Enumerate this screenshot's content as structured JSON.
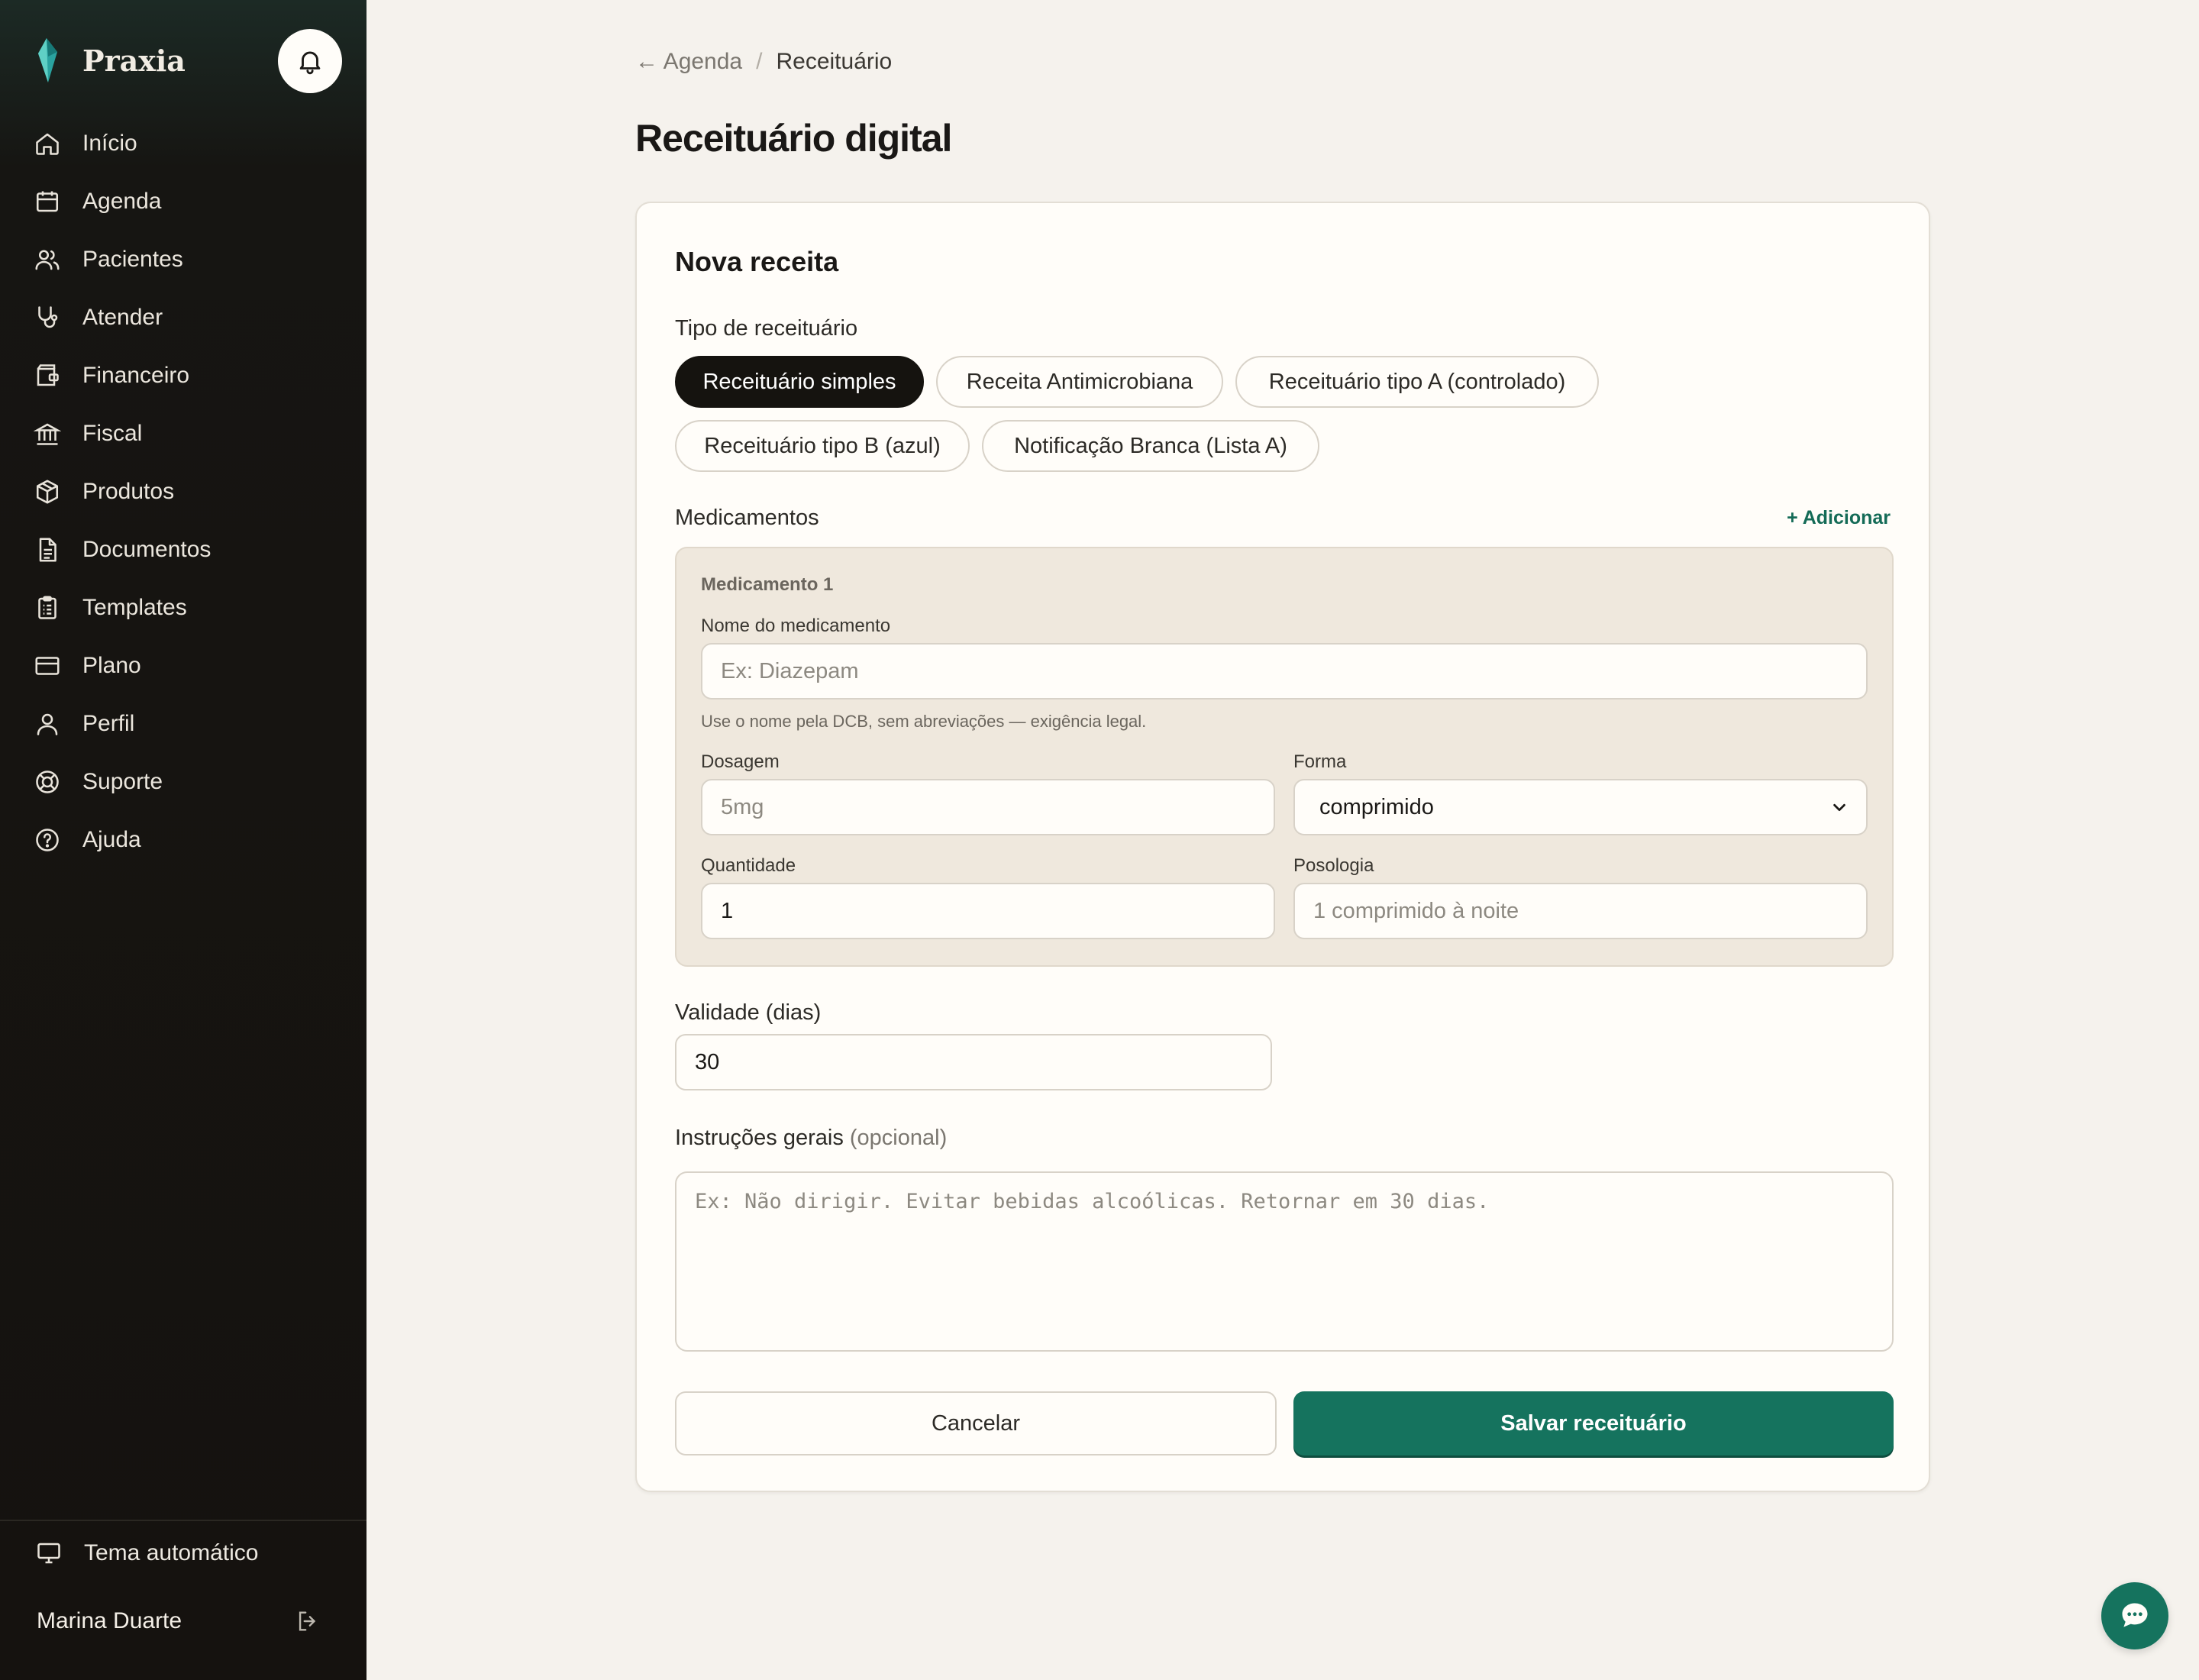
{
  "brand": {
    "name": "Praxia"
  },
  "sidebar": {
    "items": [
      {
        "label": "Início",
        "icon": "home-icon"
      },
      {
        "label": "Agenda",
        "icon": "calendar-icon"
      },
      {
        "label": "Pacientes",
        "icon": "users-icon"
      },
      {
        "label": "Atender",
        "icon": "stethoscope-icon"
      },
      {
        "label": "Financeiro",
        "icon": "wallet-icon"
      },
      {
        "label": "Fiscal",
        "icon": "bank-icon"
      },
      {
        "label": "Produtos",
        "icon": "package-icon"
      },
      {
        "label": "Documentos",
        "icon": "document-icon"
      },
      {
        "label": "Templates",
        "icon": "clipboard-list-icon"
      },
      {
        "label": "Plano",
        "icon": "credit-card-icon"
      },
      {
        "label": "Perfil",
        "icon": "user-icon"
      },
      {
        "label": "Suporte",
        "icon": "lifebuoy-icon"
      },
      {
        "label": "Ajuda",
        "icon": "help-circle-icon"
      }
    ],
    "theme_label": "Tema automático",
    "user_name": "Marina Duarte"
  },
  "breadcrumb": {
    "back": "← Agenda",
    "separator": "/",
    "current": "Receituário"
  },
  "page": {
    "title": "Receituário digital"
  },
  "form": {
    "card_title": "Nova receita",
    "type_label": "Tipo de receituário",
    "types": [
      {
        "label": "Receituário simples",
        "selected": true
      },
      {
        "label": "Receita Antimicrobiana",
        "selected": false
      },
      {
        "label": "Receituário tipo A (controlado)",
        "selected": false
      },
      {
        "label": "Receituário tipo B (azul)",
        "selected": false
      },
      {
        "label": "Notificação Branca (Lista A)",
        "selected": false
      }
    ],
    "medications_label": "Medicamentos",
    "add_label": "+ Adicionar",
    "medication": {
      "title": "Medicamento 1",
      "name_label": "Nome do medicamento",
      "name_placeholder": "Ex: Diazepam",
      "name_hint": "Use o nome pela DCB, sem abreviações — exigência legal.",
      "dosage_label": "Dosagem",
      "dosage_placeholder": "5mg",
      "form_label": "Forma",
      "form_value": "comprimido",
      "quantity_label": "Quantidade",
      "quantity_value": "1",
      "posology_label": "Posologia",
      "posology_placeholder": "1 comprimido à noite"
    },
    "validity_label": "Validade (dias)",
    "validity_value": "30",
    "instructions_label": "Instruções gerais",
    "instructions_optional": "(opcional)",
    "instructions_placeholder": "Ex: Não dirigir. Evitar bebidas alcoólicas. Retornar em 30 dias.",
    "cancel_label": "Cancelar",
    "save_label": "Salvar receituário"
  },
  "colors": {
    "accent": "#15735e",
    "sidebar_bg": "#15120f",
    "page_bg": "#f5f2ed",
    "selected_pill": "#15130f"
  }
}
